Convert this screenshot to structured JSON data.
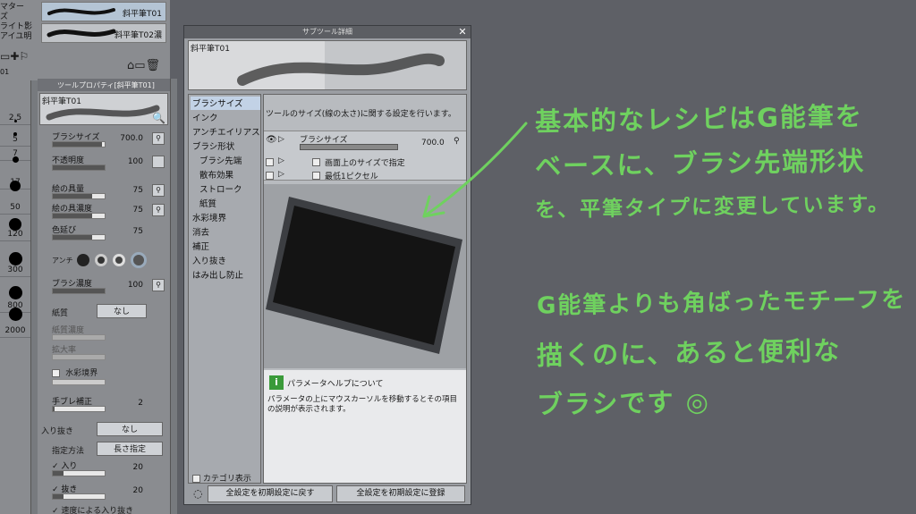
{
  "left_strip": {
    "menu_items": [
      "マター",
      "ズ",
      "ライト影",
      "アイユ明"
    ],
    "sizes": [
      "2.5",
      "5",
      "7",
      "17",
      "50",
      "120",
      "300",
      "800",
      "2000"
    ]
  },
  "subtool_list": {
    "items": [
      {
        "label": "斜平筆T01"
      },
      {
        "label": "斜平筆T02濃"
      }
    ]
  },
  "tool_property": {
    "tab_title": "ツールプロパティ[斜平筆T01]",
    "preview_label": "斜平筆T01",
    "rows": [
      {
        "name": "ブラシサイズ",
        "value": "700.0",
        "fill": 0.95
      },
      {
        "name": "不透明度",
        "value": "100",
        "fill": 1.0
      },
      {
        "name": "絵の具量",
        "value": "75",
        "fill": 0.75
      },
      {
        "name": "絵の具濃度",
        "value": "75",
        "fill": 0.75
      },
      {
        "name": "色延び",
        "value": "75",
        "fill": 0.75
      }
    ],
    "antialias_label": "アンチ",
    "brush_density": {
      "name": "ブラシ濃度",
      "value": "100"
    },
    "paper": {
      "name": "紙質",
      "value": "なし"
    },
    "paper_density": "紙質濃度",
    "scale": "拡大率",
    "watercolor_edge": "水彩境界",
    "stabilization": {
      "name": "手ブレ補正",
      "value": "2"
    },
    "taper": {
      "name": "入り抜き",
      "value": "なし"
    },
    "method": {
      "name": "指定方法",
      "value": "長さ指定"
    },
    "taper_in": {
      "name": "入り",
      "value": "20"
    },
    "taper_out": {
      "name": "抜き",
      "value": "20"
    },
    "speed": "速度による入り抜き"
  },
  "dialog": {
    "title": "サブツール詳細",
    "close": "✕",
    "preview_label": "斜平筆T01",
    "categories": [
      {
        "label": "ブラシサイズ",
        "sub": false,
        "selected": true
      },
      {
        "label": "インク",
        "sub": false
      },
      {
        "label": "アンチエイリアス",
        "sub": false
      },
      {
        "label": "ブラシ形状",
        "sub": false
      },
      {
        "label": "ブラシ先端",
        "sub": true
      },
      {
        "label": "散布効果",
        "sub": true
      },
      {
        "label": "ストローク",
        "sub": true
      },
      {
        "label": "紙質",
        "sub": true
      },
      {
        "label": "水彩境界",
        "sub": false
      },
      {
        "label": "消去",
        "sub": false
      },
      {
        "label": "補正",
        "sub": false
      },
      {
        "label": "入り抜き",
        "sub": false
      },
      {
        "label": "はみ出し防止",
        "sub": false
      }
    ],
    "description": "ツールのサイズ(線の太さ)に関する設定を行います。",
    "size_row": {
      "name": "ブラシサイズ",
      "value": "700.0"
    },
    "option1": "画面上のサイズで指定",
    "option2": "最低1ピクセル",
    "help_title": "パラメータヘルプについて",
    "help_text_1": "パラメータの上にマウスカーソルを移動するとその項目",
    "help_text_2": "の説明が表示されます。",
    "category_display": "カテゴリ表示",
    "reset_button": "全設定を初期設定に戻す",
    "register_button": "全設定を初期設定に登録"
  },
  "annotation": {
    "line1": "基本的なレシピはG能筆を",
    "line2": "ベースに、ブラシ先端形状",
    "line3": "を、平筆タイプに変更しています。",
    "line4": "G能筆よりも角ばったモチーフを",
    "line5": "描くのに、あると便利な",
    "line6": "ブラシです ◎",
    "color": "#6fd15f"
  }
}
